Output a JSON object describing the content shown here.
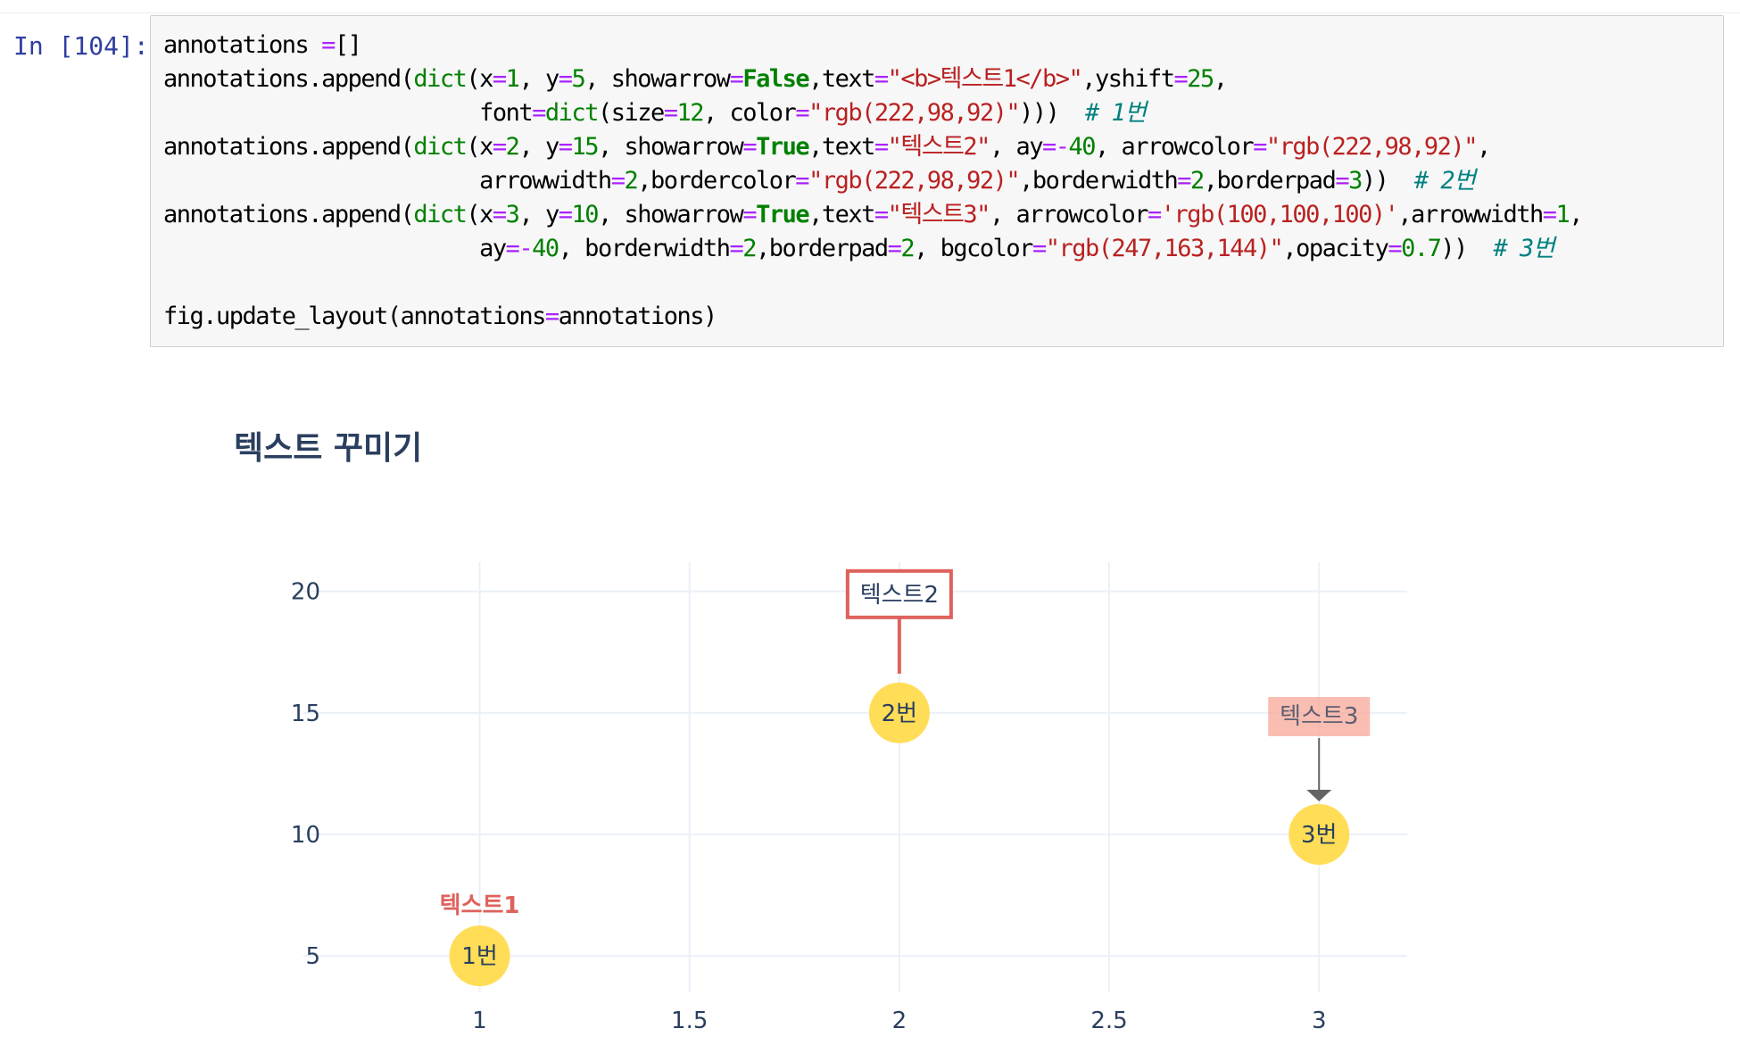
{
  "cell": {
    "prompt": "In [104]:",
    "code_lines": [
      [
        [
          "txt",
          "annotations "
        ],
        [
          "op",
          "="
        ],
        [
          "txt",
          "[]"
        ]
      ],
      [
        [
          "txt",
          "annotations.append("
        ],
        [
          "nb",
          "dict"
        ],
        [
          "txt",
          "(x"
        ],
        [
          "op",
          "="
        ],
        [
          "num",
          "1"
        ],
        [
          "txt",
          ", y"
        ],
        [
          "op",
          "="
        ],
        [
          "num",
          "5"
        ],
        [
          "txt",
          ", showarrow"
        ],
        [
          "op",
          "="
        ],
        [
          "kw",
          "False"
        ],
        [
          "txt",
          ",text"
        ],
        [
          "op",
          "="
        ],
        [
          "str",
          "\"<b>텍스트1</b>\""
        ],
        [
          "txt",
          ",yshift"
        ],
        [
          "op",
          "="
        ],
        [
          "num",
          "25"
        ],
        [
          "txt",
          ","
        ]
      ],
      [
        [
          "txt",
          "                        font"
        ],
        [
          "op",
          "="
        ],
        [
          "nb",
          "dict"
        ],
        [
          "txt",
          "(size"
        ],
        [
          "op",
          "="
        ],
        [
          "num",
          "12"
        ],
        [
          "txt",
          ", color"
        ],
        [
          "op",
          "="
        ],
        [
          "str",
          "\"rgb(222,98,92)\""
        ],
        [
          "txt",
          ")))  "
        ],
        [
          "cm",
          "# 1번"
        ]
      ],
      [
        [
          "txt",
          "annotations.append("
        ],
        [
          "nb",
          "dict"
        ],
        [
          "txt",
          "(x"
        ],
        [
          "op",
          "="
        ],
        [
          "num",
          "2"
        ],
        [
          "txt",
          ", y"
        ],
        [
          "op",
          "="
        ],
        [
          "num",
          "15"
        ],
        [
          "txt",
          ", showarrow"
        ],
        [
          "op",
          "="
        ],
        [
          "kw",
          "True"
        ],
        [
          "txt",
          ",text"
        ],
        [
          "op",
          "="
        ],
        [
          "str",
          "\"텍스트2\""
        ],
        [
          "txt",
          ", ay"
        ],
        [
          "op",
          "=-"
        ],
        [
          "num",
          "40"
        ],
        [
          "txt",
          ", arrowcolor"
        ],
        [
          "op",
          "="
        ],
        [
          "str",
          "\"rgb(222,98,92)\""
        ],
        [
          "txt",
          ","
        ]
      ],
      [
        [
          "txt",
          "                        arrowwidth"
        ],
        [
          "op",
          "="
        ],
        [
          "num",
          "2"
        ],
        [
          "txt",
          ",bordercolor"
        ],
        [
          "op",
          "="
        ],
        [
          "str",
          "\"rgb(222,98,92)\""
        ],
        [
          "txt",
          ",borderwidth"
        ],
        [
          "op",
          "="
        ],
        [
          "num",
          "2"
        ],
        [
          "txt",
          ",borderpad"
        ],
        [
          "op",
          "="
        ],
        [
          "num",
          "3"
        ],
        [
          "txt",
          "))  "
        ],
        [
          "cm",
          "# 2번"
        ]
      ],
      [
        [
          "txt",
          "annotations.append("
        ],
        [
          "nb",
          "dict"
        ],
        [
          "txt",
          "(x"
        ],
        [
          "op",
          "="
        ],
        [
          "num",
          "3"
        ],
        [
          "txt",
          ", y"
        ],
        [
          "op",
          "="
        ],
        [
          "num",
          "10"
        ],
        [
          "txt",
          ", showarrow"
        ],
        [
          "op",
          "="
        ],
        [
          "kw",
          "True"
        ],
        [
          "txt",
          ",text"
        ],
        [
          "op",
          "="
        ],
        [
          "str",
          "\"텍스트3\""
        ],
        [
          "txt",
          ", arrowcolor"
        ],
        [
          "op",
          "="
        ],
        [
          "str",
          "'rgb(100,100,100)'"
        ],
        [
          "txt",
          ",arrowwidth"
        ],
        [
          "op",
          "="
        ],
        [
          "num",
          "1"
        ],
        [
          "txt",
          ","
        ]
      ],
      [
        [
          "txt",
          "                        ay"
        ],
        [
          "op",
          "=-"
        ],
        [
          "num",
          "40"
        ],
        [
          "txt",
          ", borderwidth"
        ],
        [
          "op",
          "="
        ],
        [
          "num",
          "2"
        ],
        [
          "txt",
          ",borderpad"
        ],
        [
          "op",
          "="
        ],
        [
          "num",
          "2"
        ],
        [
          "txt",
          ", bgcolor"
        ],
        [
          "op",
          "="
        ],
        [
          "str",
          "\"rgb(247,163,144)\""
        ],
        [
          "txt",
          ",opacity"
        ],
        [
          "op",
          "="
        ],
        [
          "num",
          "0.7"
        ],
        [
          "txt",
          "))  "
        ],
        [
          "cm",
          "# 3번"
        ]
      ],
      [],
      [
        [
          "txt",
          "fig.update_layout(annotations"
        ],
        [
          "op",
          "="
        ],
        [
          "txt",
          "annotations)"
        ]
      ]
    ]
  },
  "chart_data": {
    "type": "scatter",
    "title": "텍스트 꾸미기",
    "x": [
      1,
      2,
      3
    ],
    "y": [
      5,
      15,
      10
    ],
    "point_labels": [
      "1번",
      "2번",
      "3번"
    ],
    "marker_color": "#ffdd57",
    "xlim": [
      0.58,
      3.21
    ],
    "ylim": [
      3.5,
      21.2
    ],
    "x_ticks": [
      1,
      1.5,
      2,
      2.5,
      3
    ],
    "x_tick_labels": [
      "1",
      "1.5",
      "2",
      "2.5",
      "3"
    ],
    "y_ticks": [
      5,
      10,
      15,
      20
    ],
    "y_tick_labels": [
      "5",
      "10",
      "15",
      "20"
    ],
    "grid": true,
    "annotations": [
      {
        "x": 1,
        "y": 5,
        "text": "텍스트1",
        "bold": true,
        "color": "#de625c",
        "showarrow": false
      },
      {
        "x": 2,
        "y": 15,
        "text": "텍스트2",
        "showarrow": true,
        "arrowcolor": "#de625c",
        "bordercolor": "#de625c",
        "arrowhead": false
      },
      {
        "x": 3,
        "y": 10,
        "text": "텍스트3",
        "showarrow": true,
        "arrowcolor": "#646464",
        "bgcolor": "#f7a390",
        "opacity": 0.7,
        "arrowhead": true
      }
    ]
  }
}
